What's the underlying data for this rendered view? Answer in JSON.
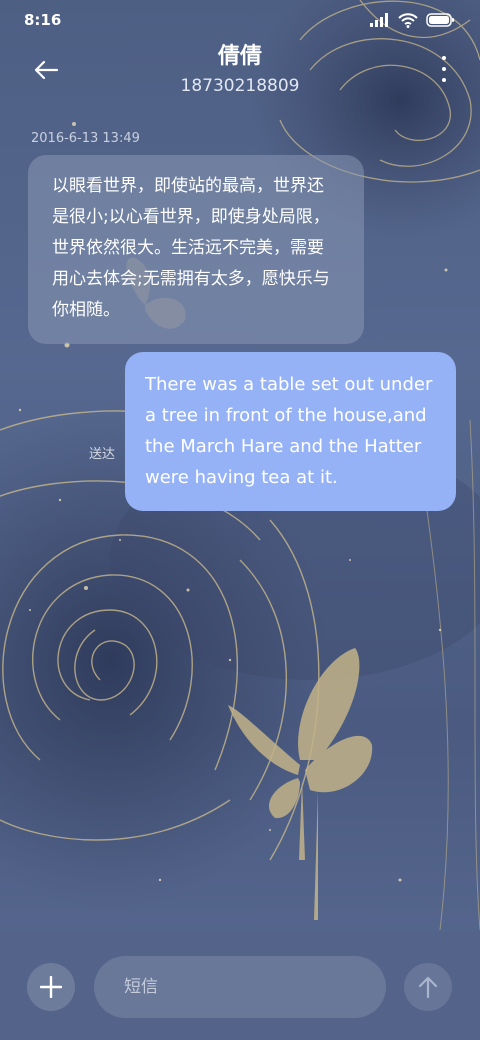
{
  "status_bar": {
    "time": "8:16",
    "icons": [
      "signal-icon",
      "wifi-icon",
      "battery-icon"
    ]
  },
  "header": {
    "back_icon": "back-arrow-icon",
    "contact_name": "倩倩",
    "contact_number": "18730218809",
    "more_icon": "more-vertical-icon"
  },
  "conversation": {
    "timestamp": "2016-6-13 13:49",
    "incoming_message": "以眼看世界，即使站的最高，世界还是很小;以心看世界，即使身处局限，世界依然很大。生活远不完美，需要用心去体会;无需拥有太多，愿快乐与你相随。",
    "outgoing_message": "There was a table set out under a tree in front of the house,and the March Hare and the Hatter were having tea at it.",
    "delivery_status": "送达"
  },
  "composer": {
    "add_icon": "plus-icon",
    "placeholder": "短信",
    "value": "",
    "send_icon": "send-arrow-icon"
  },
  "colors": {
    "background": "#4e5f84",
    "incoming_bubble": "#8c99b7",
    "outgoing_bubble": "#96b2f7",
    "art_gold": "#c8b88a"
  }
}
